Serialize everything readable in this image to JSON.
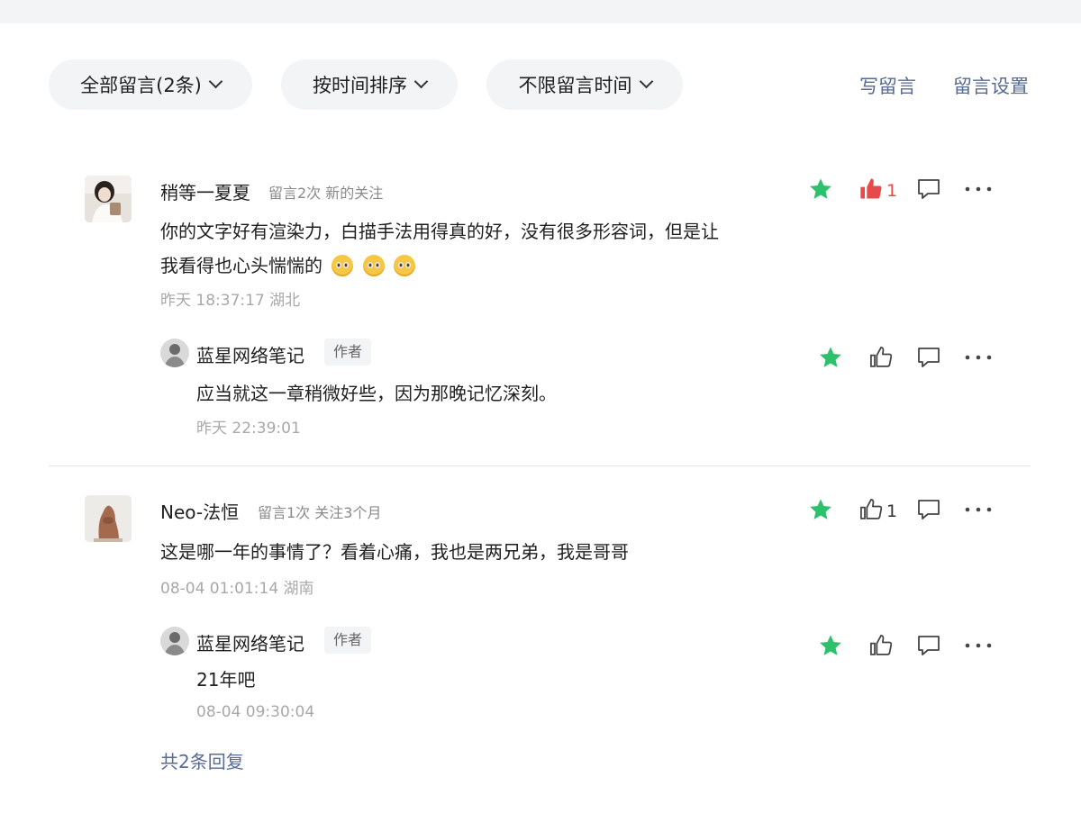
{
  "filters": {
    "all_comments": "全部留言(2条)",
    "sort": "按时间排序",
    "time_range": "不限留言时间"
  },
  "links": {
    "write": "写留言",
    "settings": "留言设置",
    "total_replies": "共2条回复"
  },
  "comments": [
    {
      "name": "稍等一夏夏",
      "meta": "留言2次  新的关注",
      "content_line1": "你的文字好有渲染力，白描手法用得真的好，没有很多形容词，但是让",
      "content_line2": "我看得也心头惴惴的",
      "time": "昨天 18:37:17 湖北",
      "likes": "1",
      "liked": true,
      "reply": {
        "name": "蓝星网络笔记",
        "badge": "作者",
        "content": "应当就这一章稍微好些，因为那晚记忆深刻。",
        "time": "昨天 22:39:01"
      }
    },
    {
      "name": "Neo-法恒",
      "meta": "留言1次  关注3个月",
      "content": "这是哪一年的事情了？看着心痛，我也是两兄弟，我是哥哥",
      "time": "08-04 01:01:14 湖南",
      "likes": "1",
      "liked": false,
      "reply": {
        "name": "蓝星网络笔记",
        "badge": "作者",
        "content": "21年吧",
        "time": "08-04 09:30:04"
      }
    }
  ],
  "colors": {
    "link": "#576b95",
    "star": "#2bc26b",
    "liked": "#e84a4a",
    "pill_bg": "#f3f4f6"
  },
  "icons": [
    "chevron-down-icon",
    "star-icon",
    "thumbs-up-icon",
    "comment-icon",
    "more-icon"
  ]
}
